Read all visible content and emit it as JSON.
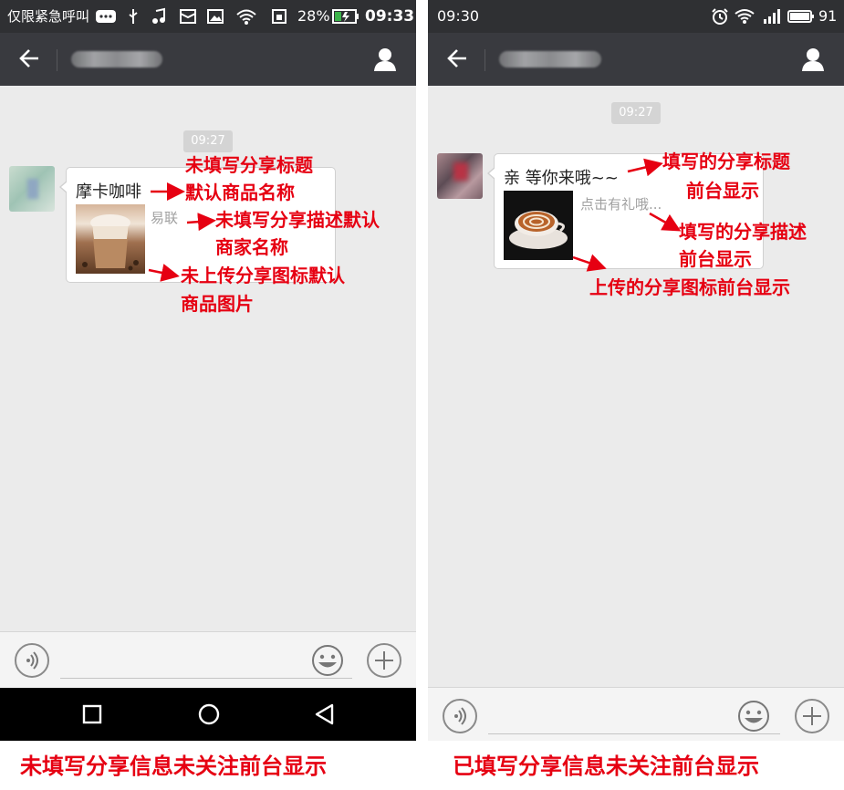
{
  "left": {
    "status_bar": {
      "carrier": "仅限紧急呼叫",
      "battery": "28%",
      "time": "09:33"
    },
    "chat": {
      "timestamp": "09:27",
      "title": "摩卡咖啡",
      "description": "易联"
    },
    "annotations": {
      "title_note_1": "未填写分享标题",
      "title_note_2": "默认商品名称",
      "desc_note_1": "未填写分享描述默认",
      "desc_note_2": "商家名称",
      "icon_note_1": "未上传分享图标默认",
      "icon_note_2": "商品图片"
    },
    "caption": "未填写分享信息未关注前台显示"
  },
  "right": {
    "status_bar": {
      "time": "09:30",
      "battery": "91"
    },
    "chat": {
      "timestamp": "09:27",
      "title": "亲 等你来哦~~",
      "description": "点击有礼哦..."
    },
    "annotations": {
      "title_note_1": "填写的分享标题",
      "title_note_2": "前台显示",
      "desc_note_1": "填写的分享描述",
      "desc_note_2": "前台显示",
      "icon_note": "上传的分享图标前台显示"
    },
    "caption": "已填写分享信息未关注前台显示"
  },
  "colors": {
    "annotation": "#e60012",
    "titlebar": "#393a3f",
    "chat_bg": "#ebebeb"
  },
  "icons": [
    "back-arrow-icon",
    "profile-icon",
    "voice-icon",
    "emoji-icon",
    "add-icon",
    "square-nav-icon",
    "circle-nav-icon",
    "triangle-back-nav-icon",
    "wifi-icon",
    "battery-icon",
    "alarm-icon",
    "signal-icon"
  ]
}
